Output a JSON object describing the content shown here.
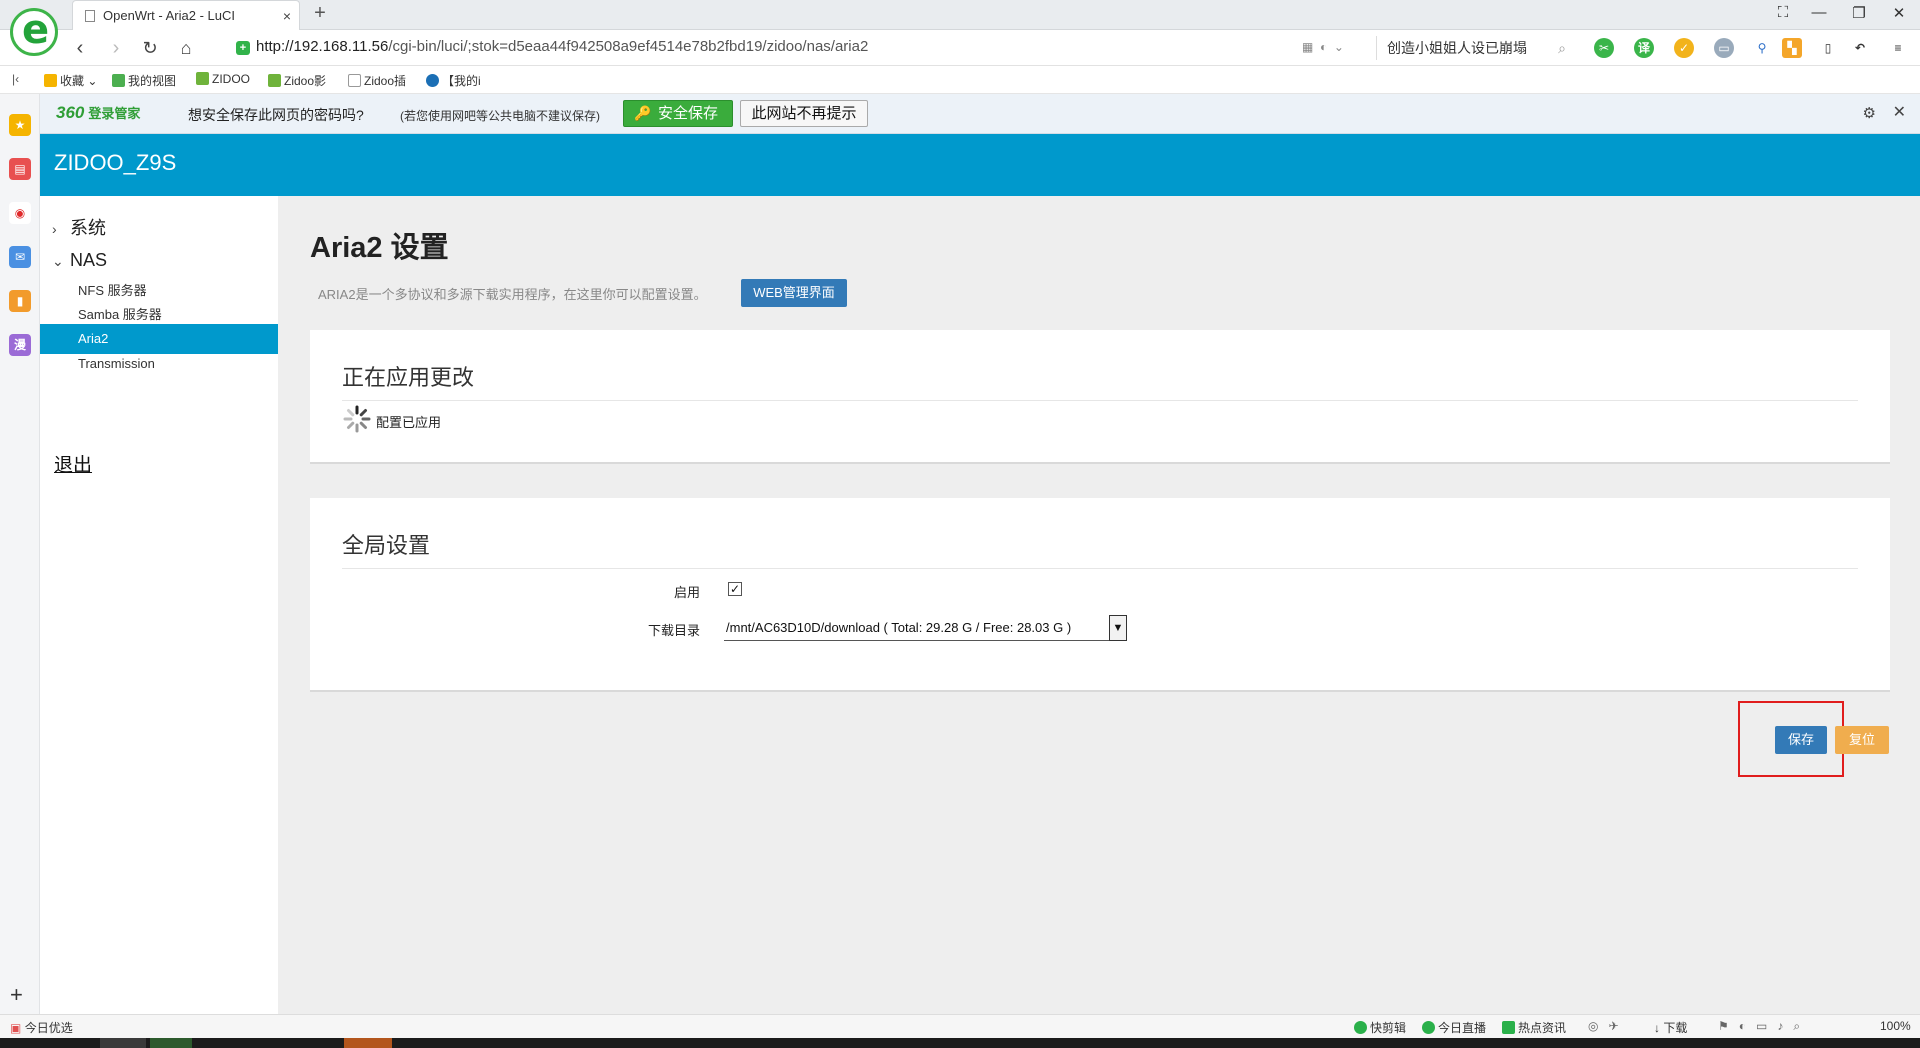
{
  "browser": {
    "tab_title": "OpenWrt - Aria2 - LuCI",
    "tab_close": "×",
    "new_tab": "+",
    "url_host": "http://192.168.11.56",
    "url_path": "/cgi-bin/luci/;stok=d5eaa44f942508a9ef4514e78b2fbd19/zidoo/nas/aria2",
    "search_text": "创造小姐姐人设已崩塌",
    "bookmarks": [
      {
        "label": "收藏",
        "color": "#f5b400"
      },
      {
        "label": "我的视图",
        "color": "#4caf50"
      },
      {
        "label": "ZIDOO",
        "color": "#6fb33b"
      },
      {
        "label": "Zidoo影",
        "color": "#6fb33b"
      },
      {
        "label": "Zidoo插",
        "color": "#bbbbbb"
      },
      {
        "label": "【我的i",
        "color": "#1b6fb5"
      }
    ]
  },
  "password_bar": {
    "brand": "360",
    "brand_sub": "登录管家",
    "question": "想安全保存此网页的密码吗?",
    "note": "(若您使用网吧等公共电脑不建议保存)",
    "save_label": "安全保存",
    "never_label": "此网站不再提示"
  },
  "luci": {
    "brand": "ZIDOO_Z9S",
    "menu": {
      "system": "系统",
      "nas": "NAS",
      "items": [
        "NFS 服务器",
        "Samba 服务器",
        "Aria2",
        "Transmission"
      ],
      "active_index": 2,
      "logout": "退出"
    },
    "title": "Aria2 设置",
    "description": "ARIA2是一个多协议和多源下载实用程序，在这里你可以配置设置。",
    "web_button": "WEB管理界面",
    "applying": {
      "title": "正在应用更改",
      "status": "配置已应用"
    },
    "global": {
      "title": "全局设置",
      "enable_label": "启用",
      "enable_checked": true,
      "enable_mark": "✓",
      "dir_label": "下载目录",
      "dir_value": "/mnt/AC63D10D/download ( Total: 29.28 G / Free: 28.03 G )"
    },
    "save_label": "保存",
    "reset_label": "复位"
  },
  "statusbar": {
    "left": "今日优选",
    "items": [
      "快剪辑",
      "今日直播",
      "热点资讯",
      "下载"
    ],
    "zoom": "100%"
  }
}
